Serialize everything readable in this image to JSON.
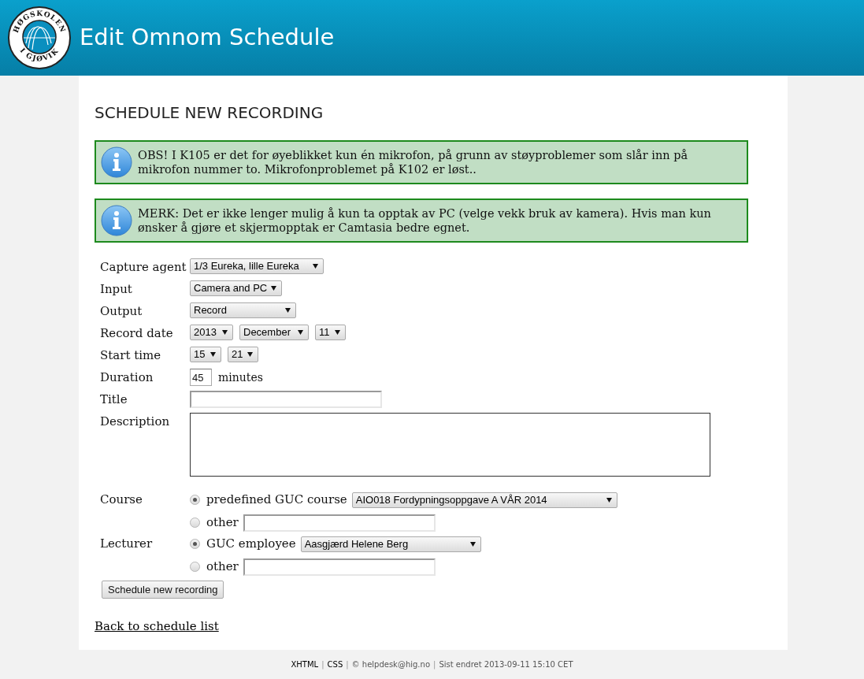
{
  "header": {
    "logo_top": "HØGSKOLEN",
    "logo_bottom": "I GJØVIK",
    "title": "Edit Omnom Schedule"
  },
  "heading": "SCHEDULE NEW RECORDING",
  "notices": [
    {
      "text": "OBS! I K105 er det for øyeblikket kun én mikrofon, på grunn av støyproblemer som slår inn på mikrofon nummer to. Mikrofonproblemet på K102 er løst.."
    },
    {
      "text": "MERK: Det er ikke lenger mulig å kun ta opptak av PC (velge vekk bruk av kamera). Hvis man kun ønsker å gjøre et skjermopptak er Camtasia bedre egnet."
    }
  ],
  "form": {
    "rows": [
      {
        "label": "Capture agent",
        "kind": "selects",
        "selects": [
          "1/3 Eureka, lille Eureka"
        ]
      },
      {
        "label": "Input",
        "kind": "selects",
        "selects": [
          "Camera and PC"
        ]
      },
      {
        "label": "Output",
        "kind": "selects",
        "selects": [
          "Record"
        ]
      },
      {
        "label": "Record date",
        "kind": "selects",
        "selects": [
          "2013",
          "December",
          "11"
        ]
      },
      {
        "label": "Start time",
        "kind": "selects",
        "selects": [
          "15",
          "21"
        ]
      },
      {
        "label": "Duration",
        "kind": "number",
        "value": "45",
        "suffix": "minutes"
      },
      {
        "label": "Title",
        "kind": "text"
      },
      {
        "label": "Description",
        "kind": "textarea"
      },
      {
        "label": "Course",
        "kind": "radio",
        "options": [
          {
            "label": "predefined GUC course",
            "selected": true,
            "kind": "select",
            "value": "AIO018 Fordypningsoppgave A VÅR 2014"
          },
          {
            "label": "other",
            "selected": false,
            "kind": "input"
          }
        ]
      },
      {
        "label": "Lecturer",
        "kind": "radio",
        "options": [
          {
            "label": "GUC employee",
            "selected": true,
            "kind": "select",
            "value": "Aasgjærd Helene Berg"
          },
          {
            "label": "other",
            "selected": false,
            "kind": "input"
          }
        ]
      }
    ],
    "submit": "Schedule new recording"
  },
  "back_link": "Back to schedule list",
  "footer": {
    "separator": "|",
    "items": [
      {
        "text": "XHTML",
        "kind": "link"
      },
      {
        "text": "CSS",
        "kind": "link"
      },
      {
        "text": "© helpdesk@hig.no",
        "kind": "text"
      },
      {
        "text": "Sist endret 2013-09-11 15:10 CET",
        "kind": "text"
      }
    ]
  }
}
